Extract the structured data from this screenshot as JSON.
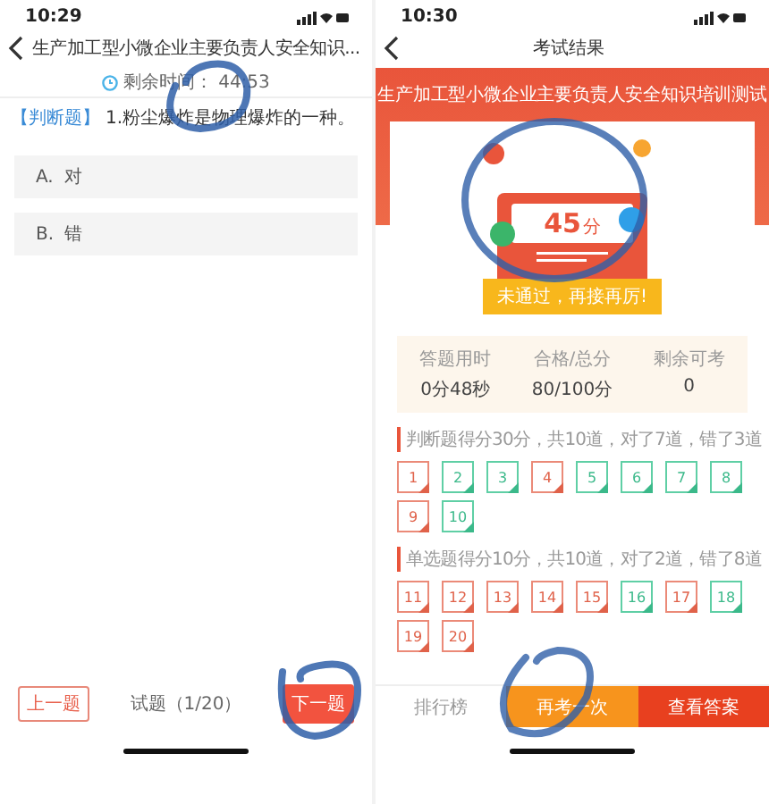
{
  "question_screen": {
    "status_time": "10:29",
    "title": "生产加工型小微企业主要负责人安全知识...",
    "timer_label": "剩余时间：",
    "timer_value": "44:53",
    "question_type": "【判断题】",
    "question_text": "1.粉尘爆炸是物理爆炸的一种。",
    "options": [
      {
        "letter": "A.",
        "text": "对",
        "selected": false
      },
      {
        "letter": "B.",
        "text": "错",
        "selected": false
      }
    ],
    "prev_button": "上一题",
    "progress": "试题（1/20）",
    "next_button": "下一题"
  },
  "result_screen": {
    "status_time": "10:30",
    "title": "考试结果",
    "exam_title": "生产加工型小微企业主要负责人安全知识培训测试",
    "score": "45",
    "score_unit": "分",
    "result_message": "未通过，再接再厉!",
    "stats": [
      {
        "label": "答题用时",
        "value": "0分48秒"
      },
      {
        "label": "合格/总分",
        "value": "80/100分"
      },
      {
        "label": "剩余可考",
        "value": "0"
      }
    ],
    "sections": [
      {
        "heading": "判断题得分30分，共10道，对了7道，错了3道",
        "items": [
          {
            "number": "1",
            "correct": false
          },
          {
            "number": "2",
            "correct": true
          },
          {
            "number": "3",
            "correct": true
          },
          {
            "number": "4",
            "correct": false
          },
          {
            "number": "5",
            "correct": true
          },
          {
            "number": "6",
            "correct": true
          },
          {
            "number": "7",
            "correct": true
          },
          {
            "number": "8",
            "correct": true
          },
          {
            "number": "9",
            "correct": false
          },
          {
            "number": "10",
            "correct": true
          }
        ]
      },
      {
        "heading": "单选题得分10分，共10道，对了2道，错了8道",
        "items": [
          {
            "number": "11",
            "correct": false
          },
          {
            "number": "12",
            "correct": false
          },
          {
            "number": "13",
            "correct": false
          },
          {
            "number": "14",
            "correct": false
          },
          {
            "number": "15",
            "correct": false
          },
          {
            "number": "16",
            "correct": true
          },
          {
            "number": "17",
            "correct": false
          },
          {
            "number": "18",
            "correct": true
          },
          {
            "number": "19",
            "correct": false
          },
          {
            "number": "20",
            "correct": false
          }
        ]
      }
    ],
    "bottom_buttons": [
      {
        "kind": "plain",
        "label": "排行榜"
      },
      {
        "kind": "orange",
        "label": "再考一次"
      },
      {
        "kind": "red",
        "label": "查看答案"
      }
    ]
  }
}
